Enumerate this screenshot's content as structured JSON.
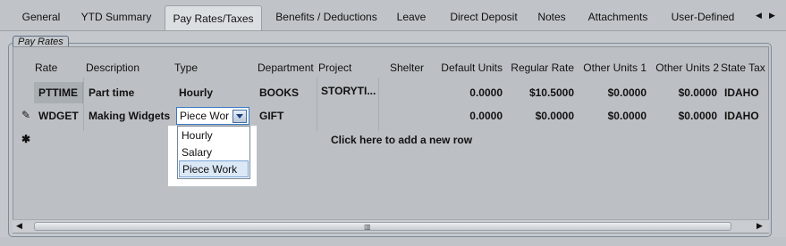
{
  "tabs": [
    {
      "label": "General"
    },
    {
      "label": "YTD Summary"
    },
    {
      "label": "Pay Rates/Taxes"
    },
    {
      "label": "Benefits / Deductions"
    },
    {
      "label": "Leave"
    },
    {
      "label": "Direct Deposit"
    },
    {
      "label": "Notes"
    },
    {
      "label": "Attachments"
    },
    {
      "label": "User-Defined"
    }
  ],
  "active_tab": "Pay Rates/Taxes",
  "group": {
    "title": "Pay Rates"
  },
  "grid": {
    "headers": {
      "rate": "Rate",
      "description": "Description",
      "type": "Type",
      "department": "Department",
      "project": "Project",
      "shelter": "Shelter",
      "default_units": "Default Units",
      "regular_rate": "Regular Rate",
      "other_units_1": "Other Units 1",
      "other_units_2": "Other Units 2",
      "state_tax": "State Tax"
    },
    "rows": [
      {
        "rate": "PTTIME",
        "description": "Part time",
        "type": "Hourly",
        "department": "BOOKS",
        "project": "STORYTI...",
        "shelter": "",
        "default_units": "0.0000",
        "regular_rate": "$10.5000",
        "other_units_1": "$0.0000",
        "other_units_2": "$0.0000",
        "state_tax": "IDAHO"
      },
      {
        "rate": "WDGET",
        "description": "Making Widgets",
        "type": "Piece Wor",
        "department": "GIFT",
        "project": "",
        "shelter": "",
        "default_units": "0.0000",
        "regular_rate": "$0.0000",
        "other_units_1": "$0.0000",
        "other_units_2": "$0.0000",
        "state_tax": "IDAHO"
      }
    ],
    "add_row_text": "Click here to add a new row"
  },
  "type_dropdown": {
    "current_value": "Piece Wor",
    "options": [
      "Hourly",
      "Salary",
      "Piece Work"
    ],
    "selected_option": "Piece Work"
  },
  "icons": {
    "edit_row": "pencil-icon",
    "new_row": "asterisk-icon",
    "tab_prev": "arrow-left-icon",
    "tab_next": "arrow-right-icon",
    "combo_open": "chevron-down-icon"
  }
}
